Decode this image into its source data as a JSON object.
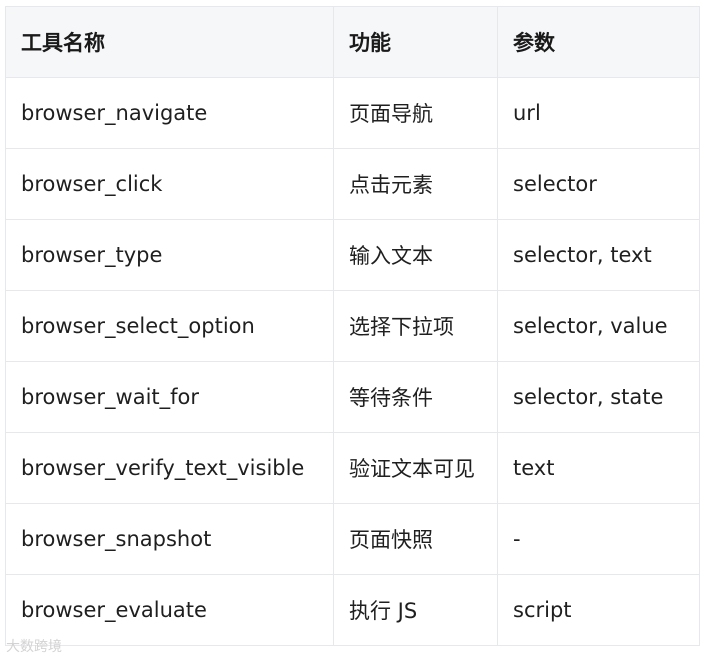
{
  "table": {
    "headers": [
      "工具名称",
      "功能",
      "参数"
    ],
    "rows": [
      [
        "browser_navigate",
        "页面导航",
        "url"
      ],
      [
        "browser_click",
        "点击元素",
        "selector"
      ],
      [
        "browser_type",
        "输入文本",
        "selector, text"
      ],
      [
        "browser_select_option",
        "选择下拉项",
        "selector, value"
      ],
      [
        "browser_wait_for",
        "等待条件",
        "selector, state"
      ],
      [
        "browser_verify_text_visible",
        "验证文本可见",
        "text"
      ],
      [
        "browser_snapshot",
        "页面快照",
        "-"
      ],
      [
        "browser_evaluate",
        "执行 JS",
        "script"
      ]
    ]
  },
  "watermark": "大数跨境"
}
